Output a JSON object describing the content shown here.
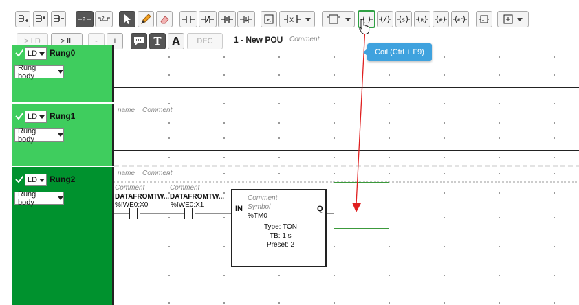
{
  "toolbar": {
    "ld_label": "> LD",
    "il_label": "> IL",
    "minus_label": "-",
    "plus_label": "+",
    "dec_label": "DEC",
    "coil_tooltip": "Coil (Ctrl + F9)"
  },
  "pou": {
    "title": "1 - New POU",
    "comment": "Comment"
  },
  "rungs": [
    {
      "lang": "LD",
      "name": "Rung0",
      "body": "Rung body"
    },
    {
      "lang": "LD",
      "name": "Rung1",
      "body": "Rung body",
      "label_name": "name",
      "label_comment": "Comment"
    },
    {
      "lang": "LD",
      "name": "Rung2",
      "body": "Rung body",
      "label_name": "name",
      "label_comment": "Comment"
    }
  ],
  "contacts": [
    {
      "comment": "Comment",
      "name": "DATAFROMTW...",
      "address": "%IWE0:X0"
    },
    {
      "comment": "Comment",
      "name": "DATAFROMTW...",
      "address": "%IWE0:X1"
    }
  ],
  "function_block": {
    "comment": "Comment",
    "symbol": "Symbol",
    "instance": "%TM0",
    "input": "IN",
    "output": "Q",
    "type": "Type: TON",
    "tb": "TB: 1 s",
    "preset": "Preset: 2"
  },
  "colors": {
    "rung_green": "#3fcd5e",
    "rung_selected": "#00922e",
    "tooltip": "#3fa2de"
  }
}
